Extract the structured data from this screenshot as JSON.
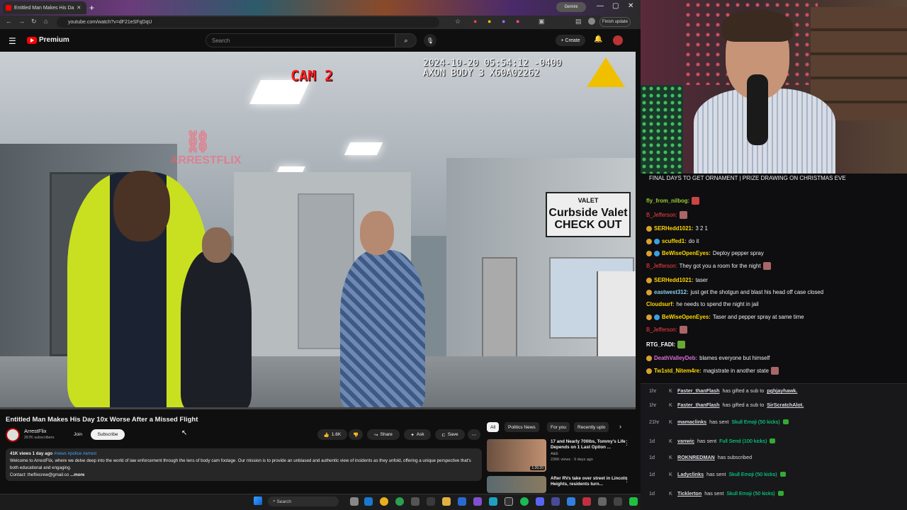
{
  "browser": {
    "tab_title": "Entitled Man Makes His Da",
    "url": "youtube.com/watch?v=dF21eSFqDqU",
    "gemini_label": "Gemini",
    "finish_update_label": "Finish update"
  },
  "youtube_header": {
    "logo_text": "Premium",
    "search_placeholder": "Search",
    "create_label": "Create"
  },
  "video_overlay": {
    "cam_label": "CAM 2",
    "timestamp_line1": "2024-10-20 05:54:12 -0400",
    "timestamp_line2": "AXON BODY 3  X60A02262",
    "watermark": "ARRESTFLIX",
    "sign_top": "VALET",
    "sign_line1": "Curbside Valet",
    "sign_line2": "CHECK OUT"
  },
  "video_info": {
    "title": "Entitled Man Makes His Day 10x Worse After a Missed Flight",
    "channel_name": "ArrestFlix",
    "channel_subs": "267K subscribers",
    "join_label": "Join",
    "subscribe_label": "Subscribe",
    "likes": "1.6K",
    "share_label": "Share",
    "ask_label": "Ask",
    "save_label": "Save",
    "desc_meta": "41K views  1 day ago",
    "desc_tags": "#news #police #arrest",
    "desc_text": "Welcome to ArrestFlix, where we delve deep into the world of law enforcement through the lens of body cam footage. Our mission is to provide an unbiased and authentic view of incidents as they unfold, offering a unique perspective that's both educational and engaging.",
    "desc_contact": "Contact: theflixcrew@gmail.co",
    "desc_more": "...more"
  },
  "rail": {
    "chips": [
      "All",
      "Politics News",
      "For you",
      "Recently uplo"
    ],
    "recs": [
      {
        "title": "17 and Nearly 700lbs, Tommy's Life Depends on 1 Last Option ...",
        "channel": "A&E",
        "meta": "236K views · 9 days ago",
        "duration": "1:26:20"
      },
      {
        "title": "After RVs take over street in Lincoln Heights, residents turn...",
        "channel": "",
        "meta": "",
        "duration": ""
      }
    ]
  },
  "taskbar": {
    "search_label": "Search"
  },
  "stream": {
    "ornament_banner": "FINAL DAYS TO GET ORNAMENT | PRIZE DRAWING ON CHRISTMAS EVE"
  },
  "chat": [
    {
      "user": "fly_from_nilbog:",
      "color": "#9acd32",
      "text": ""
    },
    {
      "user": "B_Jefferson:",
      "color": "#ff4040",
      "text": ""
    },
    {
      "user": "SERHedd1021:",
      "color": "#ffd700",
      "text": "3 2 1"
    },
    {
      "user": "scuffed1:",
      "color": "#ffd700",
      "text": "do it"
    },
    {
      "user": "BeWiseOpenEyes:",
      "color": "#ffd700",
      "text": "Deploy pepper spray"
    },
    {
      "user": "B_Jefferson:",
      "color": "#ff4040",
      "text": "They got you a room for the night"
    },
    {
      "user": "SERHedd1021:",
      "color": "#ffd700",
      "text": "taser"
    },
    {
      "user": "eastwest312:",
      "color": "#87ceeb",
      "text": "just get the shotgun and blast his head off case closed"
    },
    {
      "user": "Cloudsurf:",
      "color": "#ffd700",
      "text": "he needs to spend the night in jail"
    },
    {
      "user": "BeWiseOpenEyes:",
      "color": "#ffd700",
      "text": "Taser and pepper spray at same time"
    },
    {
      "user": "B_Jefferson:",
      "color": "#ff4040",
      "text": ""
    },
    {
      "user": "RTG_FADI:",
      "color": "#ffffff",
      "text": ""
    },
    {
      "user": "DeathValleyDeb:",
      "color": "#da70d6",
      "text": "blames everyone but himself"
    },
    {
      "user": "Tw1std_Nitem4re:",
      "color": "#ffd700",
      "text": "magistrate in another state"
    }
  ],
  "events": [
    {
      "age": "1hr",
      "user": "Faster_thanFlash",
      "text": "has gifted a sub to",
      "target": "pghjayhawk."
    },
    {
      "age": "1hr",
      "user": "Faster_thanFlash",
      "text": "has gifted a sub to",
      "target": "SirScratchAlot."
    },
    {
      "age": "21hr",
      "user": "mamaclinks",
      "text": "has sent",
      "target": "Skull Emoji (50 kicks)"
    },
    {
      "age": "1d",
      "user": "vanwic",
      "text": "has sent",
      "target": "Full Send (100 kicks)"
    },
    {
      "age": "1d",
      "user": "ROKNREDMAN",
      "text": "has subscribed",
      "target": ""
    },
    {
      "age": "1d",
      "user": "Ladyclinks",
      "text": "has sent",
      "target": "Skull Emoji (50 kicks)"
    },
    {
      "age": "1d",
      "user": "Ticklerton",
      "text": "has sent",
      "target": "Skull Emoji (50 kicks)"
    }
  ],
  "icons": [
    "hamburger-icon",
    "search-icon",
    "mic-icon",
    "bell-icon",
    "like-icon",
    "dislike-icon",
    "share-icon",
    "save-icon",
    "more-icon",
    "kick-icon"
  ]
}
